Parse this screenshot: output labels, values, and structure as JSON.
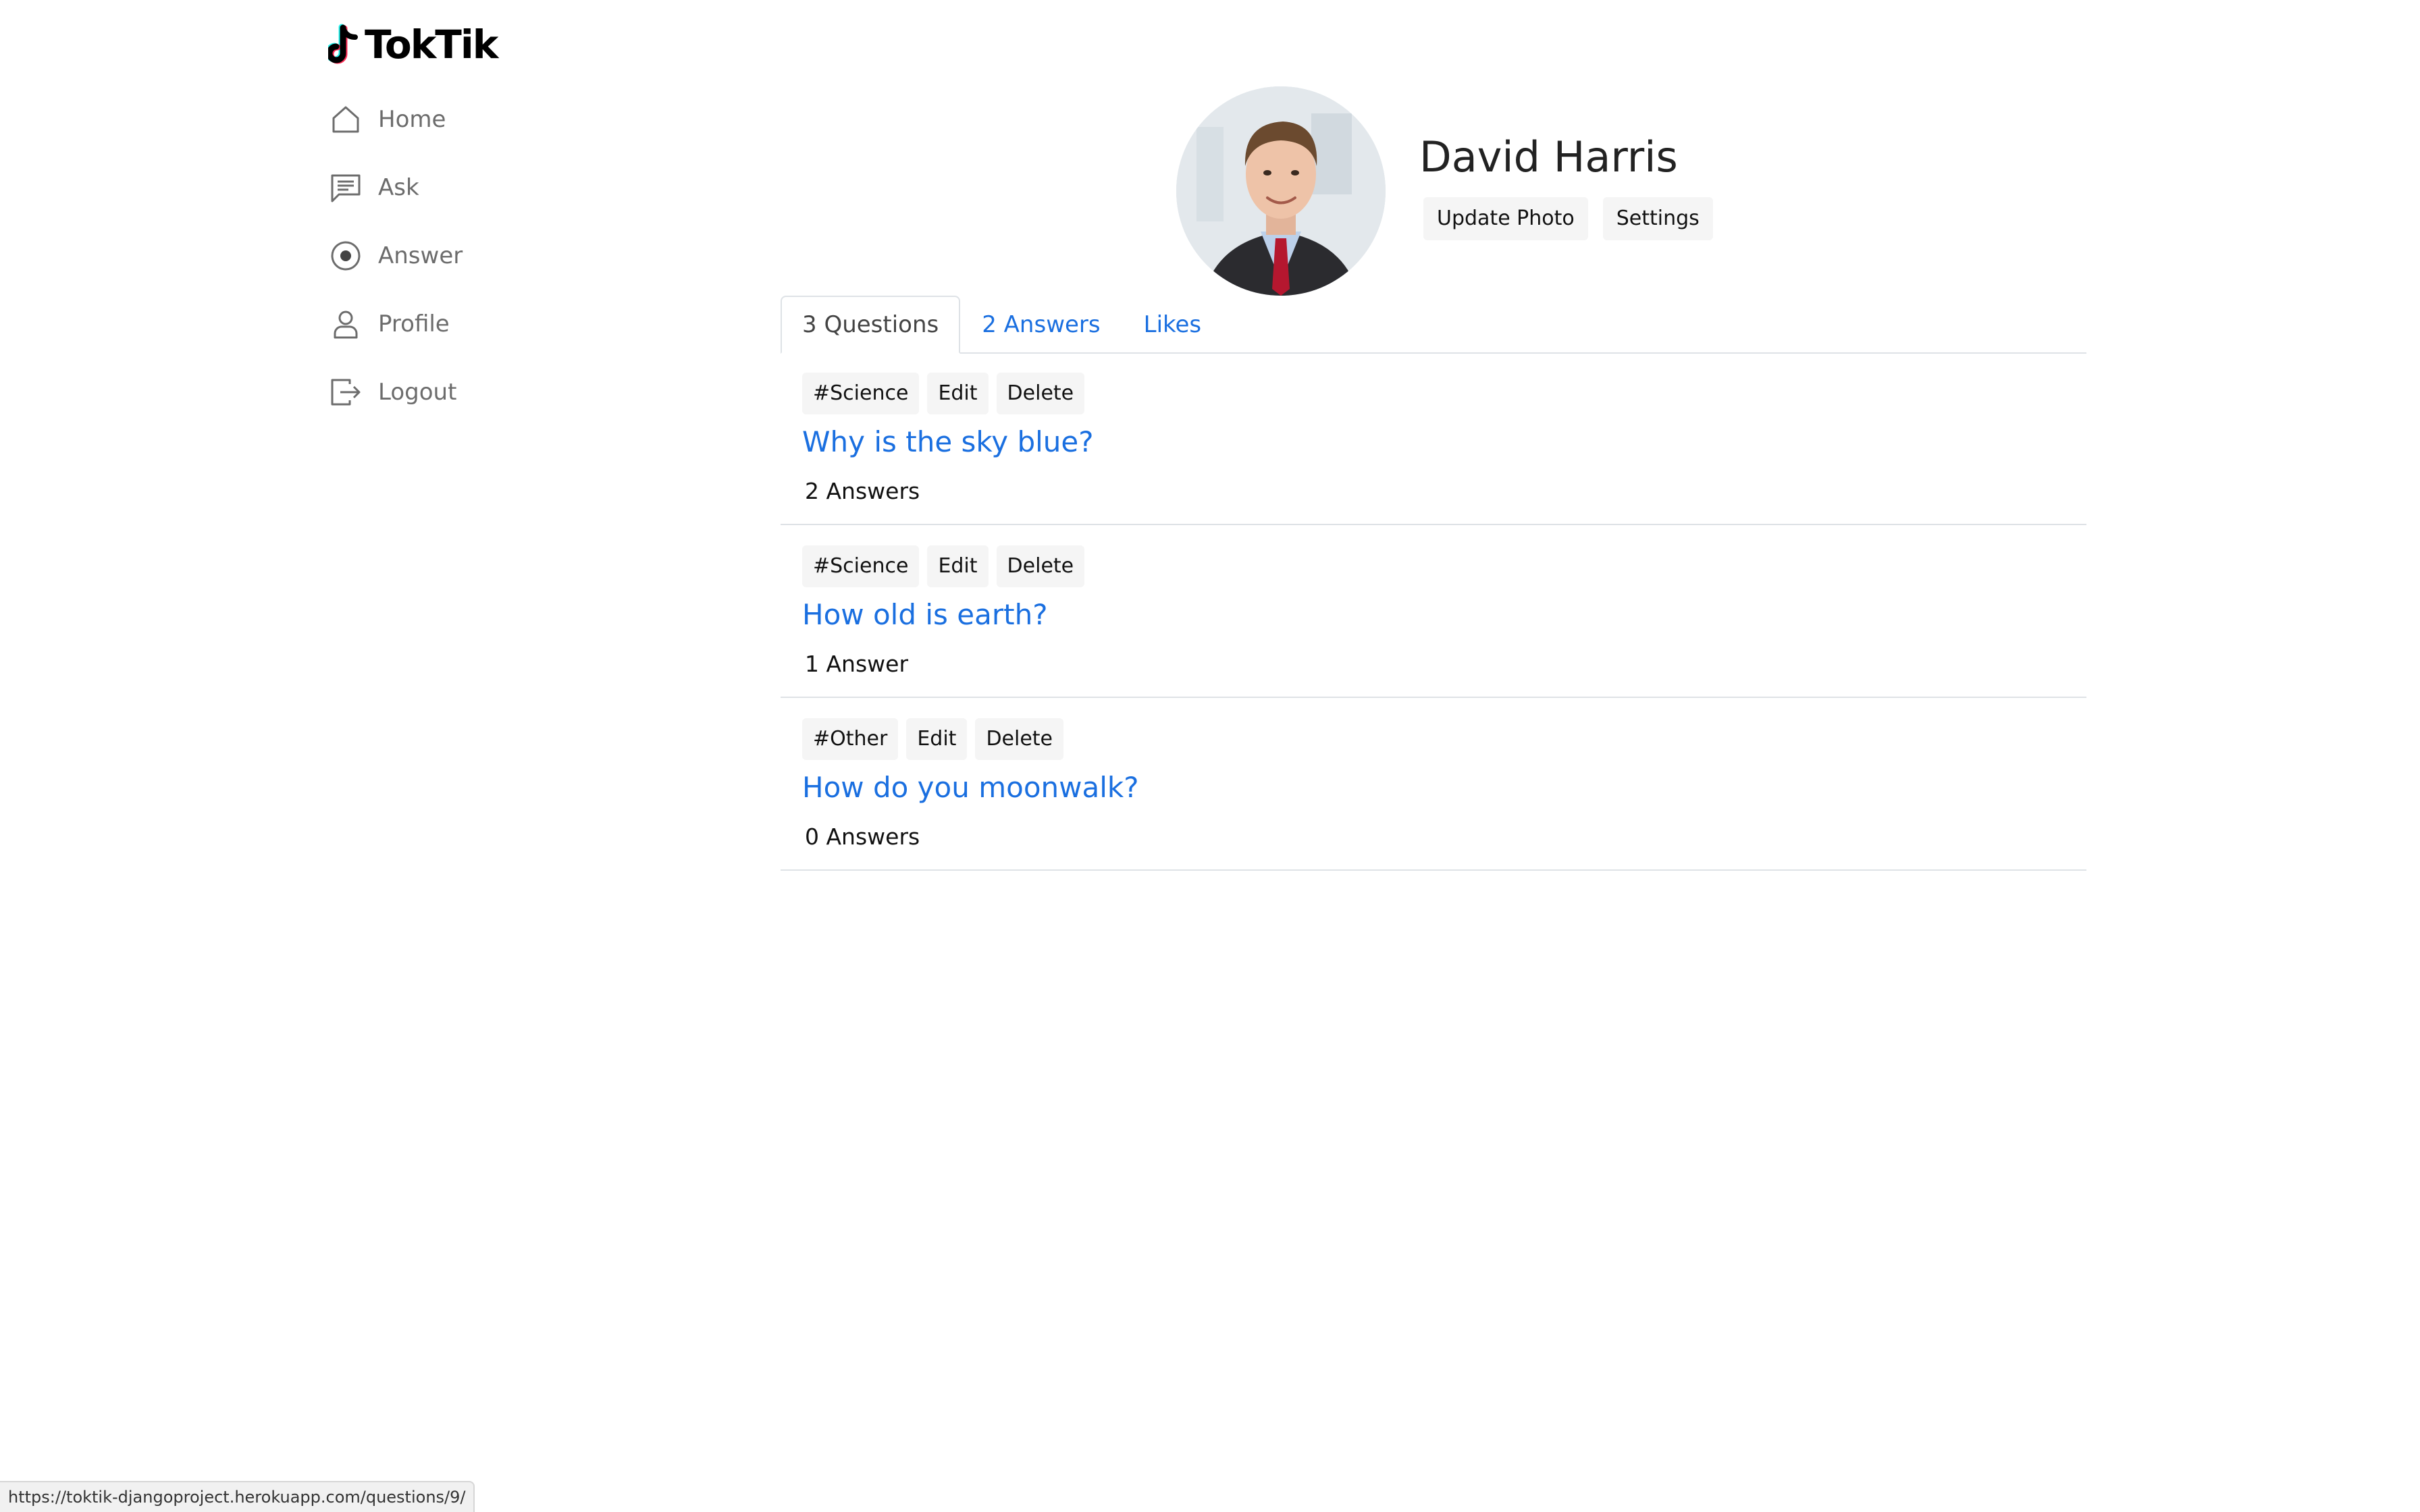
{
  "app": {
    "brand": "TokTik"
  },
  "sidebar": {
    "items": [
      {
        "label": "Home",
        "icon": "home-icon"
      },
      {
        "label": "Ask",
        "icon": "chat-icon"
      },
      {
        "label": "Answer",
        "icon": "record-icon"
      },
      {
        "label": "Profile",
        "icon": "person-icon"
      },
      {
        "label": "Logout",
        "icon": "logout-icon"
      }
    ]
  },
  "profile": {
    "name": "David Harris",
    "update_photo_label": "Update Photo",
    "settings_label": "Settings"
  },
  "tabs": [
    {
      "label": "3 Questions",
      "active": true
    },
    {
      "label": "2 Answers",
      "active": false
    },
    {
      "label": "Likes",
      "active": false
    }
  ],
  "questions": [
    {
      "tag": "#Science",
      "edit": "Edit",
      "delete": "Delete",
      "title": "Why is the sky blue?",
      "answers": "2 Answers"
    },
    {
      "tag": "#Science",
      "edit": "Edit",
      "delete": "Delete",
      "title": "How old is earth?",
      "answers": "1 Answer"
    },
    {
      "tag": "#Other",
      "edit": "Edit",
      "delete": "Delete",
      "title": "How do you moonwalk?",
      "answers": "0 Answers"
    }
  ],
  "status_bar": {
    "url": "https://toktik-djangoproject.herokuapp.com/questions/9/"
  },
  "colors": {
    "link": "#1a6fe0",
    "muted_text": "#6c6c6c",
    "badge_bg": "#f5f5f5",
    "divider": "#dee2e6"
  }
}
